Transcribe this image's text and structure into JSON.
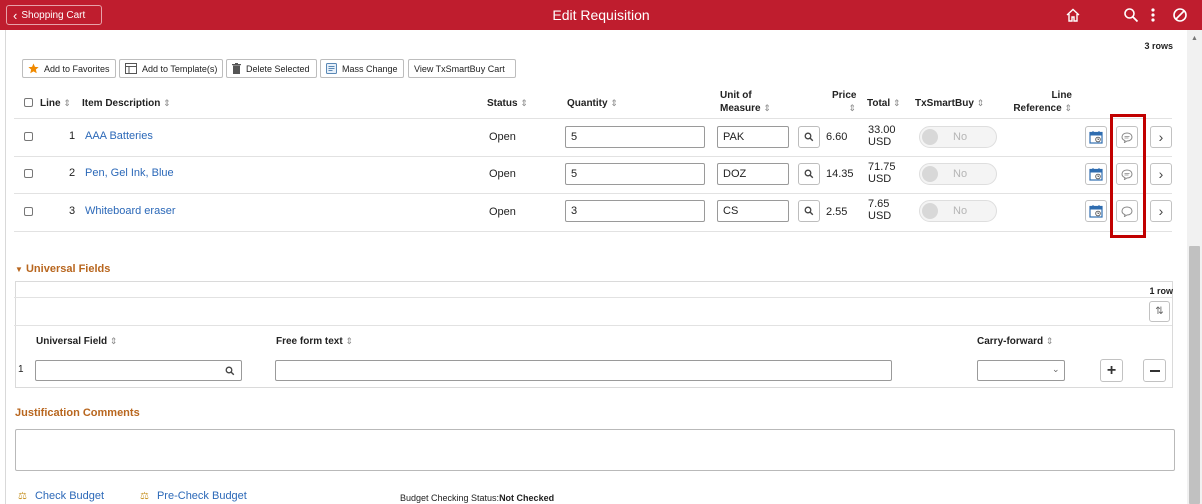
{
  "header": {
    "back_label": "Shopping Cart",
    "title": "Edit Requisition",
    "icons": [
      "home-icon",
      "search-icon",
      "more-actions-icon",
      "no-entry-icon"
    ]
  },
  "colors": {
    "banner": "#bf1d2e",
    "link": "#2b68b8",
    "section_title": "#b8661e",
    "highlight": "#c10000"
  },
  "cart": {
    "rows_count": "3 rows",
    "toolbar": {
      "add_favorites": "Add to Favorites",
      "add_template": "Add to Template(s)",
      "delete_selected": "Delete Selected",
      "mass_change": "Mass Change",
      "view_cart": "View TxSmartBuy Cart"
    },
    "columns": {
      "line": "Line",
      "item_description": "Item Description",
      "status": "Status",
      "quantity": "Quantity",
      "uom_1": "Unit of",
      "uom_2": "Measure",
      "price": "Price",
      "total": "Total",
      "txsmartbuy": "TxSmartBuy",
      "line_reference_1": "Line",
      "line_reference_2": "Reference"
    },
    "rows": [
      {
        "line": "1",
        "description": "AAA Batteries",
        "status": "Open",
        "quantity": "5",
        "uom": "PAK",
        "price": "6.60",
        "total_amount": "33.00",
        "total_currency": "USD",
        "txsmartbuy": "No",
        "comment_icon": "comment-filled-icon"
      },
      {
        "line": "2",
        "description": "Pen, Gel Ink, Blue",
        "status": "Open",
        "quantity": "5",
        "uom": "DOZ",
        "price": "14.35",
        "total_amount": "71.75",
        "total_currency": "USD",
        "txsmartbuy": "No",
        "comment_icon": "comment-filled-icon"
      },
      {
        "line": "3",
        "description": "Whiteboard eraser",
        "status": "Open",
        "quantity": "3",
        "uom": "CS",
        "price": "2.55",
        "total_amount": "7.65",
        "total_currency": "USD",
        "txsmartbuy": "No",
        "comment_icon": "comment-empty-icon"
      }
    ]
  },
  "universal": {
    "section_title": "Universal Fields",
    "rows_count": "1 row",
    "columns": {
      "universal_field": "Universal Field",
      "free_form_text": "Free form text",
      "carry_forward": "Carry-forward"
    },
    "row": {
      "number": "1",
      "universal_field": "",
      "free_form_text": "",
      "carry_forward": ""
    }
  },
  "justification": {
    "title": "Justification Comments",
    "text": ""
  },
  "footer": {
    "check_budget": "Check Budget",
    "pre_check_budget": "Pre-Check Budget",
    "status_label": "Budget Checking Status:",
    "status_value": "Not Checked"
  }
}
